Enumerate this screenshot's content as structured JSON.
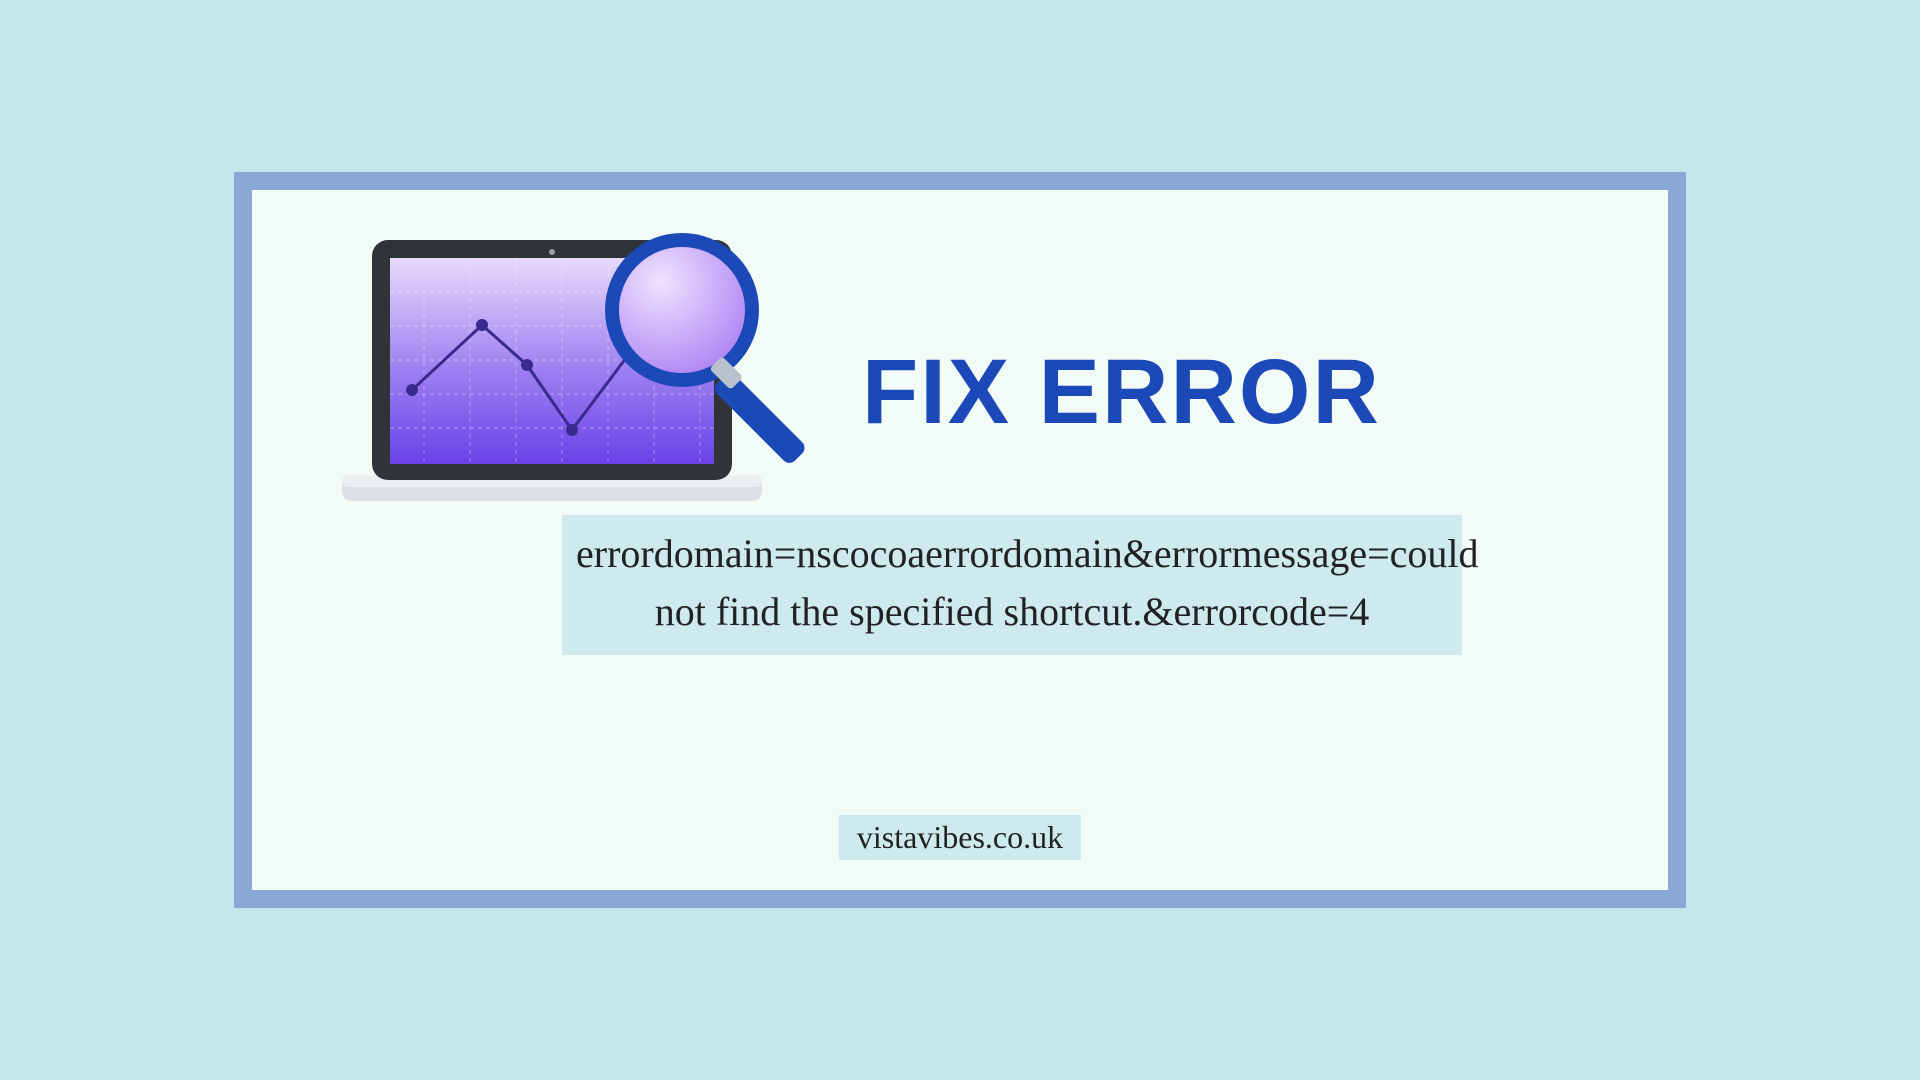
{
  "heading": "FIX ERROR",
  "error_text": "errordomain=nscocoaerrordomain&errormessage=could not find the specified shortcut.&errorcode=4",
  "site": "vistavibes.co.uk",
  "colors": {
    "page_bg": "#c4e5e9",
    "frame": "#8aa7d6",
    "panel": "#f2fbf5",
    "highlight": "#cfeaee",
    "heading": "#1b49b8",
    "text": "#202225"
  }
}
